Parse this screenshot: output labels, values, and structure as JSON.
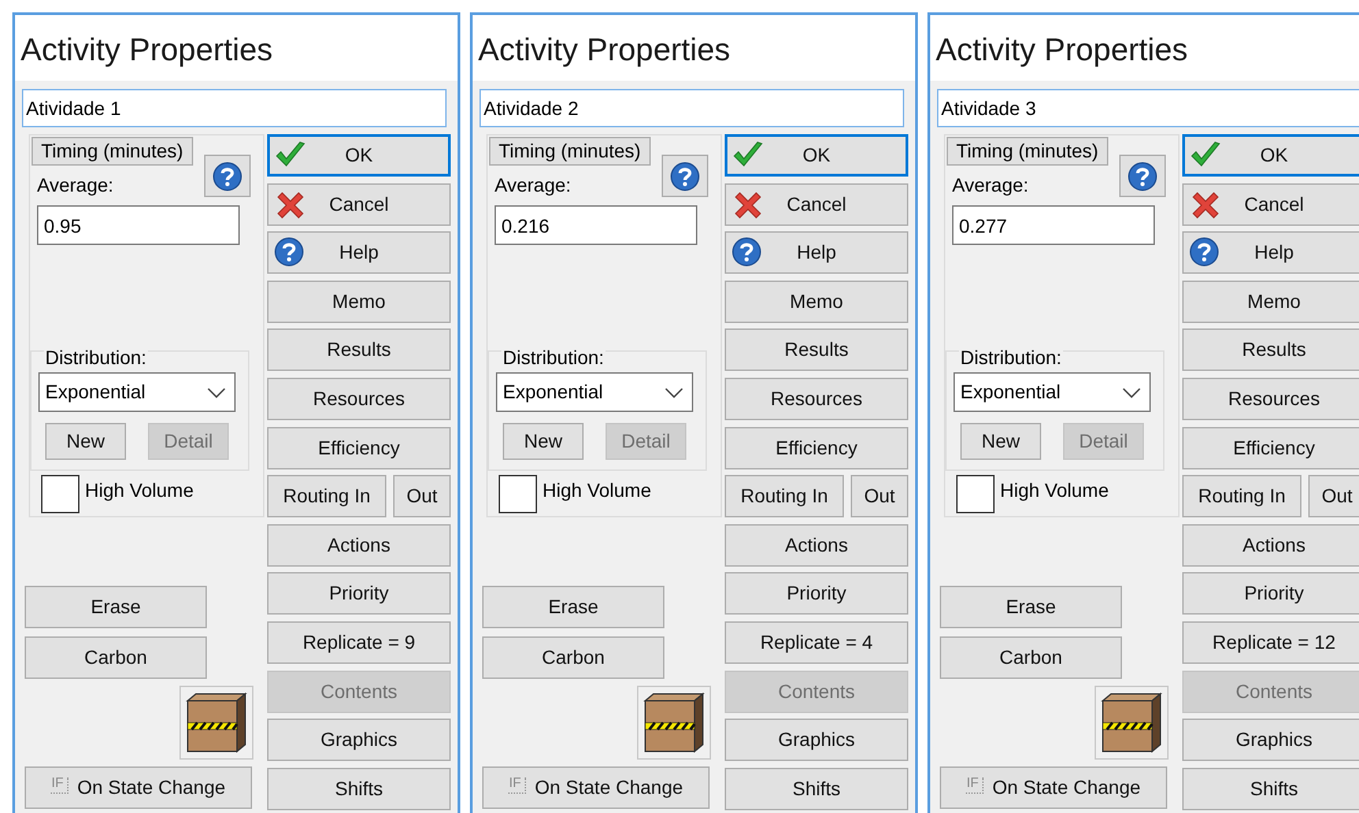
{
  "panels": [
    {
      "title": "Activity Properties",
      "name": "Atividade 1",
      "timing": {
        "label": "Timing (minutes)",
        "average_label": "Average:",
        "average": "0.95"
      },
      "distribution": {
        "label": "Distribution:",
        "value": "Exponential",
        "buttons": [
          {
            "label": "New",
            "disabled": false
          },
          {
            "label": "Detail",
            "disabled": true
          }
        ]
      },
      "high_volume": {
        "label": "High Volume",
        "checked": false
      },
      "left_buttons": [
        {
          "label": "Erase"
        },
        {
          "label": "Carbon"
        }
      ],
      "state_button": {
        "icon_text": "IF",
        "label": "On State Change"
      },
      "right_buttons": [
        [
          {
            "label": "OK",
            "kind": "ok",
            "focused": true,
            "disabled": false
          }
        ],
        [
          {
            "label": "Cancel",
            "kind": "cancel",
            "focused": false,
            "disabled": false
          }
        ],
        [
          {
            "label": "Help",
            "kind": "help",
            "focused": false,
            "disabled": false
          }
        ],
        [
          {
            "label": "Memo",
            "kind": "plain",
            "focused": false,
            "disabled": false
          }
        ],
        [
          {
            "label": "Results",
            "kind": "plain",
            "focused": false,
            "disabled": false
          }
        ],
        [
          {
            "label": "Resources",
            "kind": "plain",
            "focused": false,
            "disabled": false
          }
        ],
        [
          {
            "label": "Efficiency",
            "kind": "plain",
            "focused": false,
            "disabled": false
          }
        ],
        [
          {
            "label": "Routing In",
            "kind": "plain",
            "focused": false,
            "disabled": false
          },
          {
            "label": "Out",
            "kind": "plain",
            "focused": false,
            "disabled": false
          }
        ],
        [
          {
            "label": "Actions",
            "kind": "plain",
            "focused": false,
            "disabled": false
          }
        ],
        [
          {
            "label": "Priority",
            "kind": "plain",
            "focused": false,
            "disabled": false
          }
        ],
        [
          {
            "label": "Replicate = 9",
            "kind": "plain",
            "focused": false,
            "disabled": false
          }
        ],
        [
          {
            "label": "Contents",
            "kind": "plain",
            "focused": false,
            "disabled": true
          }
        ],
        [
          {
            "label": "Graphics",
            "kind": "plain",
            "focused": false,
            "disabled": false
          }
        ],
        [
          {
            "label": "Shifts",
            "kind": "plain",
            "focused": false,
            "disabled": false
          }
        ]
      ]
    },
    {
      "title": "Activity Properties",
      "name": "Atividade 2",
      "timing": {
        "label": "Timing (minutes)",
        "average_label": "Average:",
        "average": "0.216"
      },
      "distribution": {
        "label": "Distribution:",
        "value": "Exponential",
        "buttons": [
          {
            "label": "New",
            "disabled": false
          },
          {
            "label": "Detail",
            "disabled": true
          }
        ]
      },
      "high_volume": {
        "label": "High Volume",
        "checked": false
      },
      "left_buttons": [
        {
          "label": "Erase"
        },
        {
          "label": "Carbon"
        }
      ],
      "state_button": {
        "icon_text": "IF",
        "label": "On State Change"
      },
      "right_buttons": [
        [
          {
            "label": "OK",
            "kind": "ok",
            "focused": true,
            "disabled": false
          }
        ],
        [
          {
            "label": "Cancel",
            "kind": "cancel",
            "focused": false,
            "disabled": false
          }
        ],
        [
          {
            "label": "Help",
            "kind": "help",
            "focused": false,
            "disabled": false
          }
        ],
        [
          {
            "label": "Memo",
            "kind": "plain",
            "focused": false,
            "disabled": false
          }
        ],
        [
          {
            "label": "Results",
            "kind": "plain",
            "focused": false,
            "disabled": false
          }
        ],
        [
          {
            "label": "Resources",
            "kind": "plain",
            "focused": false,
            "disabled": false
          }
        ],
        [
          {
            "label": "Efficiency",
            "kind": "plain",
            "focused": false,
            "disabled": false
          }
        ],
        [
          {
            "label": "Routing In",
            "kind": "plain",
            "focused": false,
            "disabled": false
          },
          {
            "label": "Out",
            "kind": "plain",
            "focused": false,
            "disabled": false
          }
        ],
        [
          {
            "label": "Actions",
            "kind": "plain",
            "focused": false,
            "disabled": false
          }
        ],
        [
          {
            "label": "Priority",
            "kind": "plain",
            "focused": false,
            "disabled": false
          }
        ],
        [
          {
            "label": "Replicate = 4",
            "kind": "plain",
            "focused": false,
            "disabled": false
          }
        ],
        [
          {
            "label": "Contents",
            "kind": "plain",
            "focused": false,
            "disabled": true
          }
        ],
        [
          {
            "label": "Graphics",
            "kind": "plain",
            "focused": false,
            "disabled": false
          }
        ],
        [
          {
            "label": "Shifts",
            "kind": "plain",
            "focused": false,
            "disabled": false
          }
        ]
      ]
    },
    {
      "title": "Activity Properties",
      "name": "Atividade 3",
      "timing": {
        "label": "Timing (minutes)",
        "average_label": "Average:",
        "average": "0.277"
      },
      "distribution": {
        "label": "Distribution:",
        "value": "Exponential",
        "buttons": [
          {
            "label": "New",
            "disabled": false
          },
          {
            "label": "Detail",
            "disabled": true
          }
        ]
      },
      "high_volume": {
        "label": "High Volume",
        "checked": false
      },
      "left_buttons": [
        {
          "label": "Erase"
        },
        {
          "label": "Carbon"
        }
      ],
      "state_button": {
        "icon_text": "IF",
        "label": "On State Change"
      },
      "right_buttons": [
        [
          {
            "label": "OK",
            "kind": "ok",
            "focused": true,
            "disabled": false
          }
        ],
        [
          {
            "label": "Cancel",
            "kind": "cancel",
            "focused": false,
            "disabled": false
          }
        ],
        [
          {
            "label": "Help",
            "kind": "help",
            "focused": false,
            "disabled": false
          }
        ],
        [
          {
            "label": "Memo",
            "kind": "plain",
            "focused": false,
            "disabled": false
          }
        ],
        [
          {
            "label": "Results",
            "kind": "plain",
            "focused": false,
            "disabled": false
          }
        ],
        [
          {
            "label": "Resources",
            "kind": "plain",
            "focused": false,
            "disabled": false
          }
        ],
        [
          {
            "label": "Efficiency",
            "kind": "plain",
            "focused": false,
            "disabled": false
          }
        ],
        [
          {
            "label": "Routing In",
            "kind": "plain",
            "focused": false,
            "disabled": false
          },
          {
            "label": "Out",
            "kind": "plain",
            "focused": false,
            "disabled": false
          }
        ],
        [
          {
            "label": "Actions",
            "kind": "plain",
            "focused": false,
            "disabled": false
          }
        ],
        [
          {
            "label": "Priority",
            "kind": "plain",
            "focused": false,
            "disabled": false
          }
        ],
        [
          {
            "label": "Replicate = 12",
            "kind": "plain",
            "focused": false,
            "disabled": false
          }
        ],
        [
          {
            "label": "Contents",
            "kind": "plain",
            "focused": false,
            "disabled": true
          }
        ],
        [
          {
            "label": "Graphics",
            "kind": "plain",
            "focused": false,
            "disabled": false
          }
        ],
        [
          {
            "label": "Shifts",
            "kind": "plain",
            "focused": false,
            "disabled": false
          }
        ]
      ]
    }
  ]
}
